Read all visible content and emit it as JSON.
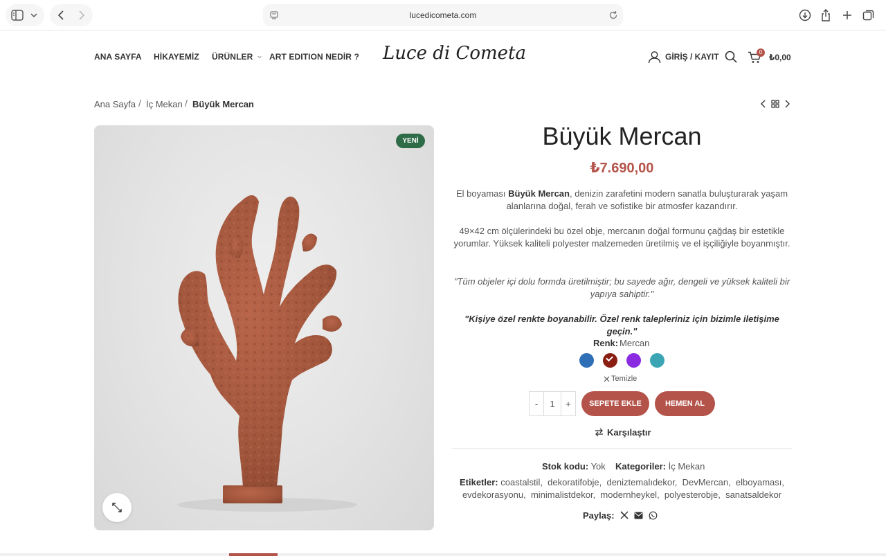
{
  "browser": {
    "url": "lucedicometa.com"
  },
  "header": {
    "nav": [
      {
        "label": "ANA SAYFA"
      },
      {
        "label": "HİKAYEMİZ"
      },
      {
        "label": "ÜRÜNLER"
      },
      {
        "label": "ART EDITION NEDİR ?"
      }
    ],
    "logo": "Luce di Cometa",
    "login_label": "GİRİŞ / KAYIT",
    "cart_count": "0",
    "cart_total": "₺0,00"
  },
  "breadcrumb": {
    "items": [
      "Ana Sayfa",
      "İç Mekan",
      "Büyük Mercan"
    ]
  },
  "product": {
    "badge": "YENİ",
    "title": "Büyük Mercan",
    "price": "₺7.690,00",
    "desc1_prefix": "El boyaması ",
    "desc1_bold": "Büyük Mercan",
    "desc1_suffix": ", denizin zarafetini modern sanatla buluşturarak yaşam alanlarına doğal, ferah ve sofistike bir atmosfer kazandırır.",
    "desc2": "49×42 cm ölçülerindeki bu özel obje, mercanın doğal formunu çağdaş bir estetikle yorumlar. Yüksek kaliteli polyester malzemeden üretilmiş ve el işçiliğiyle boyanmıştır.",
    "quote1": "\"Tüm objeler içi dolu formda üretilmiştir; bu sayede ağır, dengeli ve yüksek kaliteli bir yapıya sahiptir.\"",
    "quote2": "\"Kişiye özel renkte boyanabilir. Özel renk talepleriniz için bizimle iletişime geçin.\"",
    "color_label": "Renk",
    "color_value": "Mercan",
    "swatches": [
      {
        "name": "mavi",
        "color": "#2f6fb7"
      },
      {
        "name": "mercan",
        "color": "#8b1e12",
        "selected": true
      },
      {
        "name": "mor",
        "color": "#8a2be2"
      },
      {
        "name": "turkuaz",
        "color": "#3ba5b3"
      }
    ],
    "clear_label": "Temizle",
    "qty_minus": "-",
    "qty_value": "1",
    "qty_plus": "+",
    "add_to_cart": "SEPETE EKLE",
    "buy_now": "HEMEN AL",
    "compare": "Karşılaştır",
    "sku_label": "Stok kodu:",
    "sku_value": "Yok",
    "category_label": "Kategoriler:",
    "category_value": "İç Mekan",
    "tags_label": "Etiketler:",
    "tags": [
      "coastalstil",
      "dekoratifobje",
      "deniztemalıdekor",
      "DevMercan",
      "elboyaması",
      "evdekorasyonu",
      "minimalistdekor",
      "modernheykel",
      "polyesterobje",
      "sanatsaldekor"
    ],
    "share_label": "Paylaş:"
  },
  "colors": {
    "accent": "#b4534a",
    "badge": "#2e6b47",
    "coral": "#a9553a"
  }
}
